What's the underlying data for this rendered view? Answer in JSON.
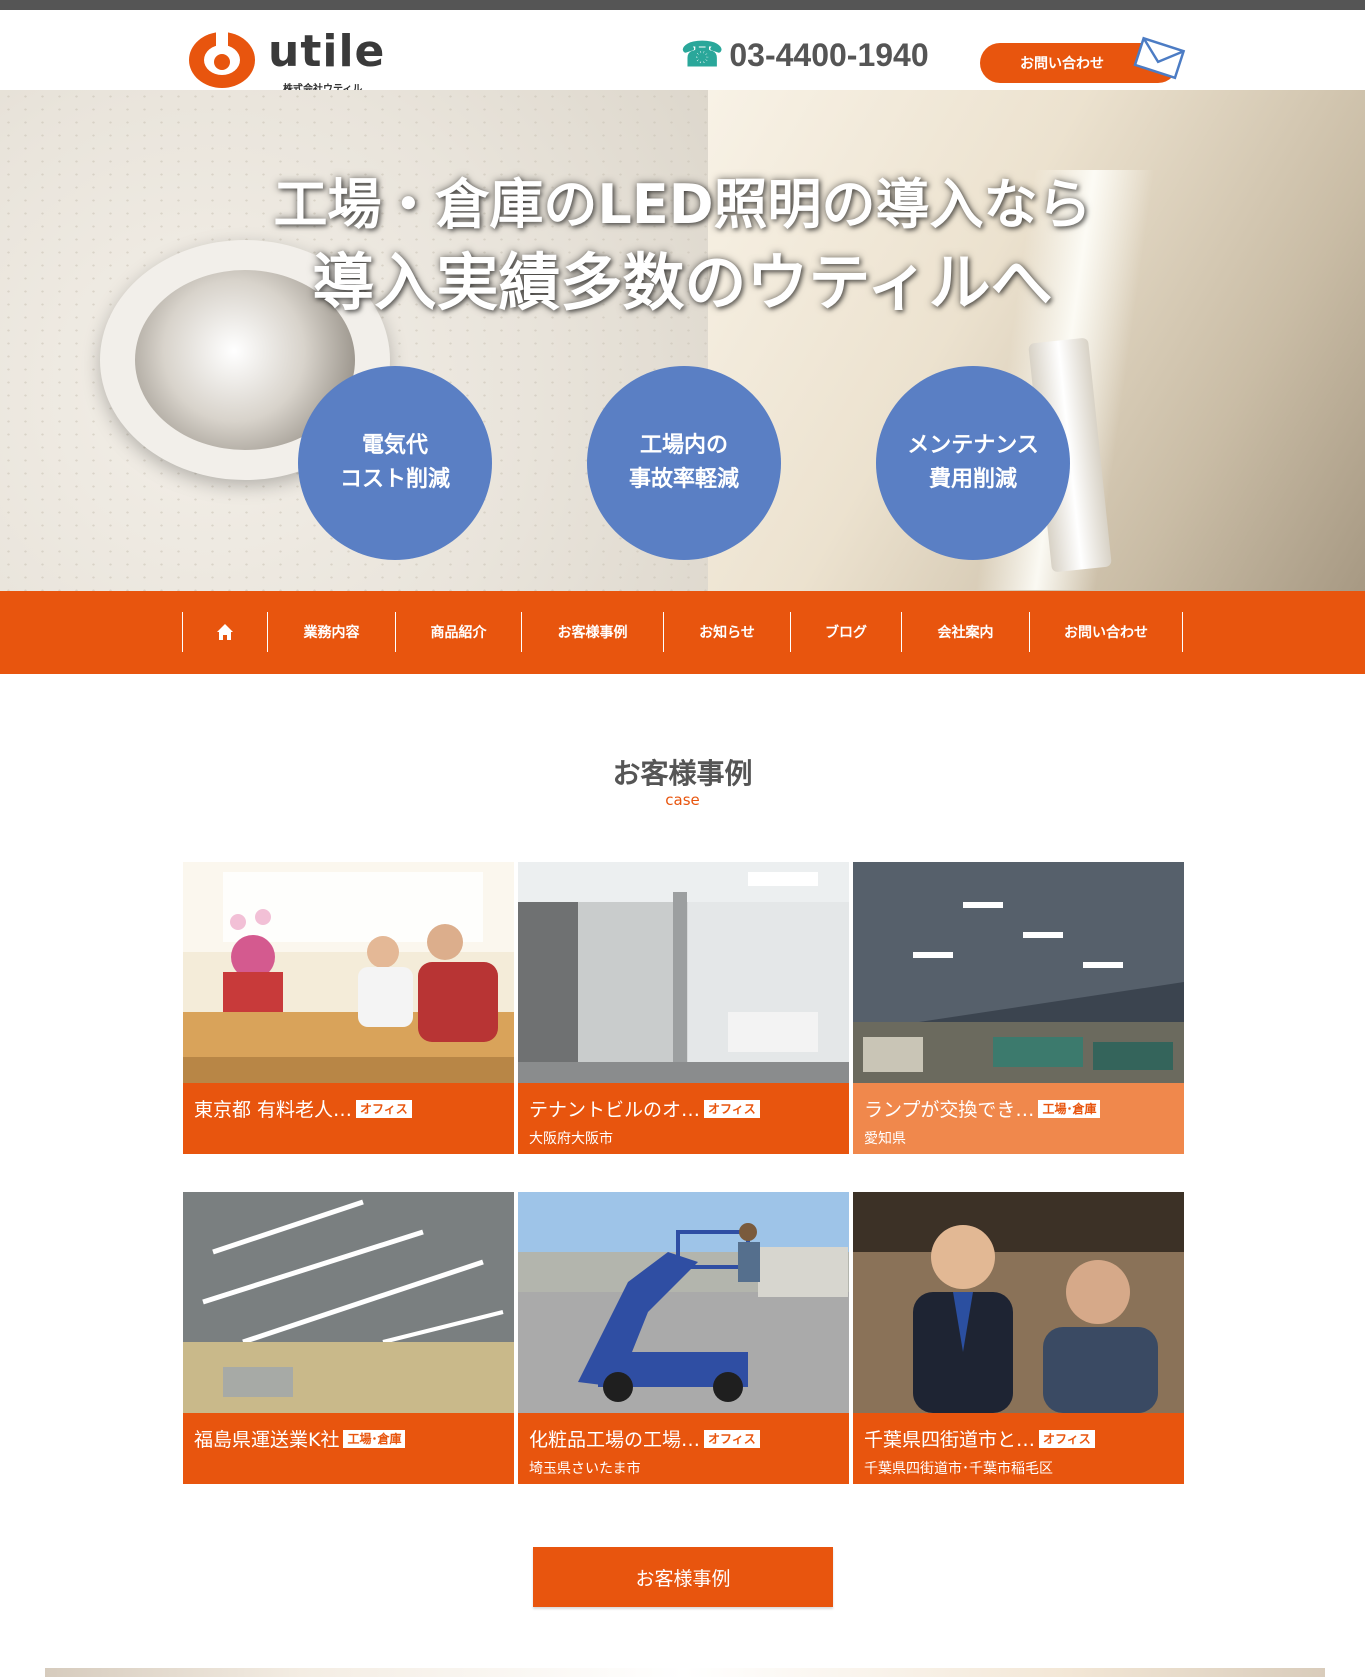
{
  "header": {
    "logo_text": "utile",
    "logo_sub": "株式会社ウティル",
    "phone": "03-4400-1940",
    "contact_label": "お問い合わせ"
  },
  "hero": {
    "line1": "工場・倉庫のLED照明の導入なら",
    "line2": "導入実績多数のウティルへ",
    "bubbles": [
      "電気代\nコスト削減",
      "工場内の\n事故率軽減",
      "メンテナンス\n費用削減"
    ]
  },
  "nav": {
    "items": [
      "業務内容",
      "商品紹介",
      "お客様事例",
      "お知らせ",
      "ブログ",
      "会社案内",
      "お問い合わせ"
    ]
  },
  "section": {
    "title": "お客様事例",
    "subtitle": "case"
  },
  "cases": [
    {
      "title": "東京都 有料老人…",
      "tag": "オフィス",
      "location": ""
    },
    {
      "title": "テナントビルのオ…",
      "tag": "オフィス",
      "location": "大阪府大阪市"
    },
    {
      "title": "ランプが交換でき…",
      "tag": "工場･倉庫",
      "location": "愛知県"
    },
    {
      "title": "福島県運送業K社",
      "tag": "工場･倉庫",
      "location": ""
    },
    {
      "title": "化粧品工場の工場…",
      "tag": "オフィス",
      "location": "埼玉県さいたま市"
    },
    {
      "title": "千葉県四街道市と…",
      "tag": "オフィス",
      "location": "千葉県四街道市･千葉市稲毛区"
    }
  ],
  "more_button": "お客様事例",
  "colors": {
    "accent": "#e8550e",
    "bubble": "#5a7fc4",
    "phone_icon": "#2aa79a"
  }
}
